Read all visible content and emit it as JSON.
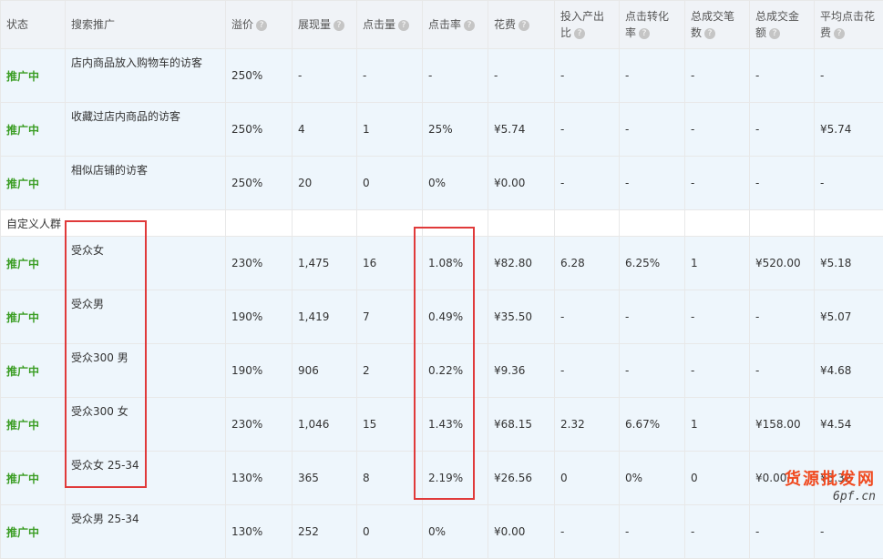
{
  "headers": [
    {
      "label": "状态",
      "help": false
    },
    {
      "label": "搜索推广",
      "help": false
    },
    {
      "label": "溢价",
      "help": true
    },
    {
      "label": "展现量",
      "help": true
    },
    {
      "label": "点击量",
      "help": true
    },
    {
      "label": "点击率",
      "help": true
    },
    {
      "label": "花费",
      "help": true
    },
    {
      "label": "投入产出比",
      "help": true
    },
    {
      "label": "点击转化率",
      "help": true
    },
    {
      "label": "总成交笔数",
      "help": true
    },
    {
      "label": "总成交金额",
      "help": true
    },
    {
      "label": "平均点击花费",
      "help": true
    }
  ],
  "help_glyph": "?",
  "group_label": "自定义人群",
  "rows_top": [
    {
      "status": "推广中",
      "name": "店内商品放入购物车的访客",
      "premium": "250%",
      "impressions": "-",
      "clicks": "-",
      "ctr": "-",
      "cost": "-",
      "roi": "-",
      "cvr": "-",
      "orders": "-",
      "gmv": "-",
      "cpc": "-"
    },
    {
      "status": "推广中",
      "name": "收藏过店内商品的访客",
      "premium": "250%",
      "impressions": "4",
      "clicks": "1",
      "ctr": "25%",
      "cost": "¥5.74",
      "roi": "-",
      "cvr": "-",
      "orders": "-",
      "gmv": "-",
      "cpc": "¥5.74"
    },
    {
      "status": "推广中",
      "name": "相似店铺的访客",
      "premium": "250%",
      "impressions": "20",
      "clicks": "0",
      "ctr": "0%",
      "cost": "¥0.00",
      "roi": "-",
      "cvr": "-",
      "orders": "-",
      "gmv": "-",
      "cpc": "-"
    }
  ],
  "rows_custom": [
    {
      "status": "推广中",
      "name": "受众女",
      "premium": "230%",
      "impressions": "1,475",
      "clicks": "16",
      "ctr": "1.08%",
      "cost": "¥82.80",
      "roi": "6.28",
      "cvr": "6.25%",
      "orders": "1",
      "gmv": "¥520.00",
      "cpc": "¥5.18"
    },
    {
      "status": "推广中",
      "name": "受众男",
      "premium": "190%",
      "impressions": "1,419",
      "clicks": "7",
      "ctr": "0.49%",
      "cost": "¥35.50",
      "roi": "-",
      "cvr": "-",
      "orders": "-",
      "gmv": "-",
      "cpc": "¥5.07"
    },
    {
      "status": "推广中",
      "name": "受众300 男",
      "premium": "190%",
      "impressions": "906",
      "clicks": "2",
      "ctr": "0.22%",
      "cost": "¥9.36",
      "roi": "-",
      "cvr": "-",
      "orders": "-",
      "gmv": "-",
      "cpc": "¥4.68"
    },
    {
      "status": "推广中",
      "name": "受众300 女",
      "premium": "230%",
      "impressions": "1,046",
      "clicks": "15",
      "ctr": "1.43%",
      "cost": "¥68.15",
      "roi": "2.32",
      "cvr": "6.67%",
      "orders": "1",
      "gmv": "¥158.00",
      "cpc": "¥4.54"
    },
    {
      "status": "推广中",
      "name": "受众女 25-34",
      "premium": "130%",
      "impressions": "365",
      "clicks": "8",
      "ctr": "2.19%",
      "cost": "¥26.56",
      "roi": "0",
      "cvr": "0%",
      "orders": "0",
      "gmv": "¥0.00",
      "cpc": "¥3.32"
    },
    {
      "status": "推广中",
      "name": "受众男 25-34",
      "premium": "130%",
      "impressions": "252",
      "clicks": "0",
      "ctr": "0%",
      "cost": "¥0.00",
      "roi": "-",
      "cvr": "-",
      "orders": "-",
      "gmv": "-",
      "cpc": "-"
    }
  ],
  "annotation_color": "#e03a3a",
  "watermark": {
    "main": "货源批发网",
    "sub": "6pf.cn"
  }
}
